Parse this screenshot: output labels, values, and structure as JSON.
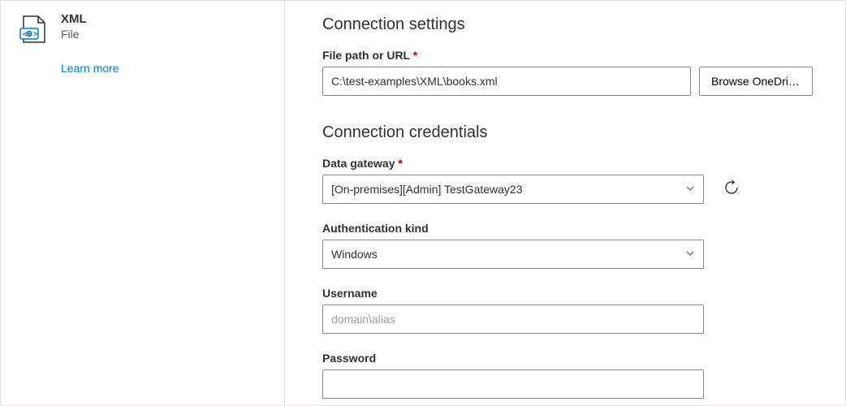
{
  "sidebar": {
    "connector_title": "XML",
    "connector_subtitle": "File",
    "learn_more_label": "Learn more"
  },
  "connection_settings": {
    "heading": "Connection settings",
    "file_path": {
      "label": "File path or URL",
      "required": "*",
      "value": "C:\\test-examples\\XML\\books.xml"
    },
    "browse_label": "Browse OneDrive..."
  },
  "credentials": {
    "heading": "Connection credentials",
    "data_gateway": {
      "label": "Data gateway",
      "required": "*",
      "selected": "[On-premises][Admin] TestGateway23"
    },
    "auth_kind": {
      "label": "Authentication kind",
      "selected": "Windows"
    },
    "username": {
      "label": "Username",
      "placeholder": "domain\\alias",
      "value": ""
    },
    "password": {
      "label": "Password",
      "value": ""
    }
  }
}
